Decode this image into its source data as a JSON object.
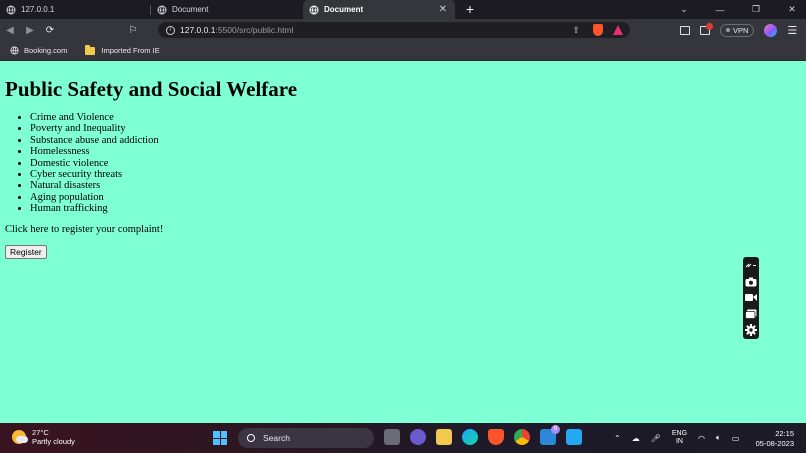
{
  "browser": {
    "tabs": [
      {
        "label": "127.0.0.1",
        "active": false
      },
      {
        "label": "Document",
        "active": false
      },
      {
        "label": "Document",
        "active": true
      }
    ],
    "url_host": "127.0.0.1",
    "url_path": ":5500/src/public.html",
    "vpn_label": "VPN",
    "bookmarks": [
      {
        "label": "Booking.com",
        "icon": "globe-icon"
      },
      {
        "label": "Imported From IE",
        "icon": "folder-icon"
      }
    ]
  },
  "page": {
    "heading": "Public Safety and Social Welfare",
    "issues": [
      "Crime and Violence",
      "Poverty and Inequality",
      "Substance abuse and addiction",
      "Homelessness",
      "Domestic violence",
      "Cyber security threats",
      "Natural disasters",
      "Aging population",
      "Human trafficking"
    ],
    "cta_text": "Click here to register your complaint!",
    "register_label": "Register",
    "background_color": "#7fffd4"
  },
  "taskbar": {
    "temperature": "27°C",
    "condition": "Partly cloudy",
    "search_placeholder": "Search",
    "mail_badge": "8",
    "lang_1": "ENG",
    "lang_2": "IN",
    "time": "22:15",
    "date": "05-08-2023"
  }
}
